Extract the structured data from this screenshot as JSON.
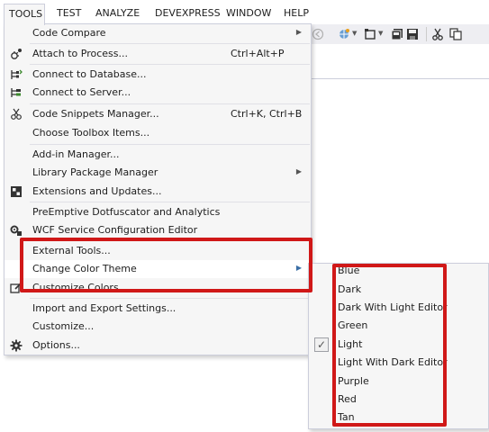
{
  "menubar": {
    "items": [
      "TOOLS",
      "TEST",
      "ANALYZE",
      "DEVEXPRESS",
      "WINDOW",
      "HELP"
    ]
  },
  "toolbar": {
    "icons": [
      "back-icon",
      "browser-icon",
      "dropdown-arrow-icon",
      "frame-icon",
      "dropdown-arrow-icon",
      "save-all-icon",
      "save-icon",
      "cut-icon",
      "copy-icon"
    ]
  },
  "tools_menu": {
    "items": [
      {
        "label": "Code Compare",
        "shortcut": "",
        "submenu": true,
        "icon": ""
      },
      {
        "label": "Attach to Process...",
        "shortcut": "Ctrl+Alt+P",
        "submenu": false,
        "icon": "attach-process-icon"
      },
      {
        "label": "Connect to Database...",
        "shortcut": "",
        "submenu": false,
        "icon": "connect-database-icon"
      },
      {
        "label": "Connect to Server...",
        "shortcut": "",
        "submenu": false,
        "icon": "connect-server-icon"
      },
      {
        "label": "Code Snippets Manager...",
        "shortcut": "Ctrl+K, Ctrl+B",
        "submenu": false,
        "icon": "snippets-icon"
      },
      {
        "label": "Choose Toolbox Items...",
        "shortcut": "",
        "submenu": false,
        "icon": ""
      },
      {
        "label": "Add-in Manager...",
        "shortcut": "",
        "submenu": false,
        "icon": ""
      },
      {
        "label": "Library Package Manager",
        "shortcut": "",
        "submenu": true,
        "icon": ""
      },
      {
        "label": "Extensions and Updates...",
        "shortcut": "",
        "submenu": false,
        "icon": "extensions-icon"
      },
      {
        "label": "PreEmptive Dotfuscator and Analytics",
        "shortcut": "",
        "submenu": false,
        "icon": ""
      },
      {
        "label": "WCF Service Configuration Editor",
        "shortcut": "",
        "submenu": false,
        "icon": "wcf-config-icon"
      },
      {
        "label": "External Tools...",
        "shortcut": "",
        "submenu": false,
        "icon": ""
      },
      {
        "label": "Change Color Theme",
        "shortcut": "",
        "submenu": true,
        "icon": ""
      },
      {
        "label": "Customize Colors",
        "shortcut": "",
        "submenu": false,
        "icon": "customize-colors-icon"
      },
      {
        "label": "Import and Export Settings...",
        "shortcut": "",
        "submenu": false,
        "icon": ""
      },
      {
        "label": "Customize...",
        "shortcut": "",
        "submenu": false,
        "icon": ""
      },
      {
        "label": "Options...",
        "shortcut": "",
        "submenu": false,
        "icon": "gear-icon"
      }
    ]
  },
  "theme_submenu": {
    "items": [
      {
        "label": "Blue",
        "checked": false
      },
      {
        "label": "Dark",
        "checked": false
      },
      {
        "label": "Dark With Light Editor",
        "checked": false
      },
      {
        "label": "Green",
        "checked": false
      },
      {
        "label": "Light",
        "checked": true
      },
      {
        "label": "Light With Dark Editor",
        "checked": false
      },
      {
        "label": "Purple",
        "checked": false
      },
      {
        "label": "Red",
        "checked": false
      },
      {
        "label": "Tan",
        "checked": false
      }
    ],
    "check_glyph": "✓"
  },
  "colors": {
    "highlight": "#d01818",
    "menu_bg": "#f6f6f6",
    "border": "#cccedb"
  }
}
